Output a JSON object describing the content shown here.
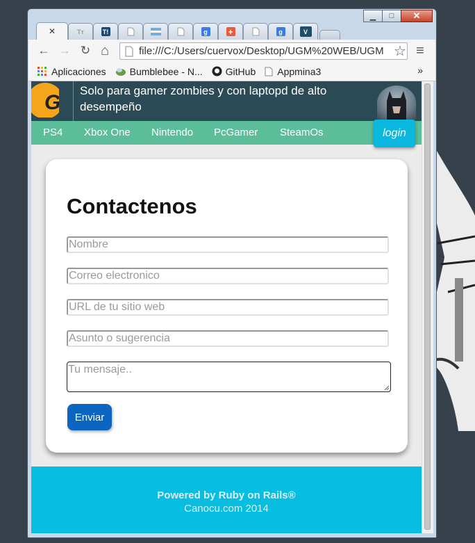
{
  "window": {
    "minimize_glyph": "▁",
    "maximize_glyph": "□",
    "close_glyph": "✕"
  },
  "tabs": [
    {
      "icon": "close-icon",
      "glyph": "✕",
      "active": true
    },
    {
      "icon": "tt-favicon",
      "glyph": "Tт"
    },
    {
      "icon": "t-favicon",
      "glyph": "T!"
    },
    {
      "icon": "page-icon",
      "glyph": ""
    },
    {
      "icon": "flag-favicon",
      "glyph": ""
    },
    {
      "icon": "page-icon",
      "glyph": ""
    },
    {
      "icon": "google-favicon",
      "glyph": "g"
    },
    {
      "icon": "plus-favicon",
      "glyph": "+"
    },
    {
      "icon": "page-icon",
      "glyph": ""
    },
    {
      "icon": "google-favicon",
      "glyph": "g"
    },
    {
      "icon": "v-favicon",
      "glyph": "V"
    }
  ],
  "toolbar": {
    "back": "←",
    "forward": "→",
    "reload": "↻",
    "home": "⌂",
    "url": "file:///C:/Users/cuervox/Desktop/UGM%20WEB/UGM",
    "star": "☆",
    "menu": "≡"
  },
  "bookmarks": [
    {
      "label": "Aplicaciones",
      "icon": "apps-grid-icon"
    },
    {
      "label": "Bumblebee - N...",
      "icon": "bumblebee-icon"
    },
    {
      "label": "GitHub",
      "icon": "github-icon"
    },
    {
      "label": "Appmina3",
      "icon": "page-icon"
    }
  ],
  "bookmarks_overflow": "»",
  "site": {
    "logo_letter": "G",
    "title": "Solo para gamer zombies y con laptopd de alto desempeño",
    "nav": [
      "PS4",
      "Xbox One",
      "Nintendo",
      "PcGamer",
      "SteamOs"
    ],
    "login": "login"
  },
  "contact": {
    "heading": "Contactenos",
    "fields": [
      {
        "placeholder": "Nombre"
      },
      {
        "placeholder": "Correo electronico"
      },
      {
        "placeholder": "URL de tu sitio web"
      },
      {
        "placeholder": "Asunto o sugerencia"
      }
    ],
    "message_placeholder": "Tu mensaje..",
    "submit": "Enviar"
  },
  "footer": {
    "line1": "Powered by Ruby on Rails®",
    "line2": "Canocu.com 2014"
  },
  "colors": {
    "header_bg": "#2c4a55",
    "nav_bg": "#5bbd9a",
    "login_bg": "#09b7df",
    "button_bg": "#0a66c0",
    "footer_bg": "#08bee0"
  }
}
